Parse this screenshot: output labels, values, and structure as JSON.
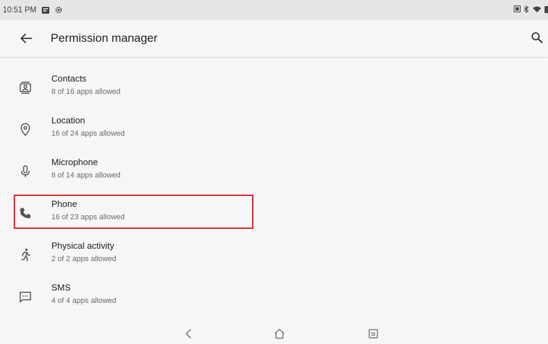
{
  "status_bar": {
    "time": "10:51 PM",
    "left_icons": [
      "notification-icon",
      "settings-icon"
    ],
    "right_icons": [
      "screenshot-icon",
      "bluetooth-icon",
      "wifi-icon",
      "battery-icon"
    ]
  },
  "header": {
    "title": "Permission manager",
    "back_icon": "arrow-back-icon",
    "search_icon": "search-icon"
  },
  "permissions": [
    {
      "label": "Contacts",
      "sub": "8 of 16 apps allowed",
      "icon": "contacts-icon"
    },
    {
      "label": "Location",
      "sub": "16 of 24 apps allowed",
      "icon": "location-icon"
    },
    {
      "label": "Microphone",
      "sub": "8 of 14 apps allowed",
      "icon": "microphone-icon"
    },
    {
      "label": "Phone",
      "sub": "16 of 23 apps allowed",
      "icon": "phone-icon",
      "highlighted": true
    },
    {
      "label": "Physical activity",
      "sub": "2 of 2 apps allowed",
      "icon": "physical-activity-icon"
    },
    {
      "label": "SMS",
      "sub": "4 of 4 apps allowed",
      "icon": "sms-icon"
    }
  ],
  "nav_bar": {
    "buttons": [
      "back-nav-icon",
      "home-nav-icon",
      "recents-nav-icon"
    ]
  },
  "colors": {
    "background": "#f6f6f6",
    "status_bar": "#e6e6e6",
    "highlight": "#d9262a"
  }
}
